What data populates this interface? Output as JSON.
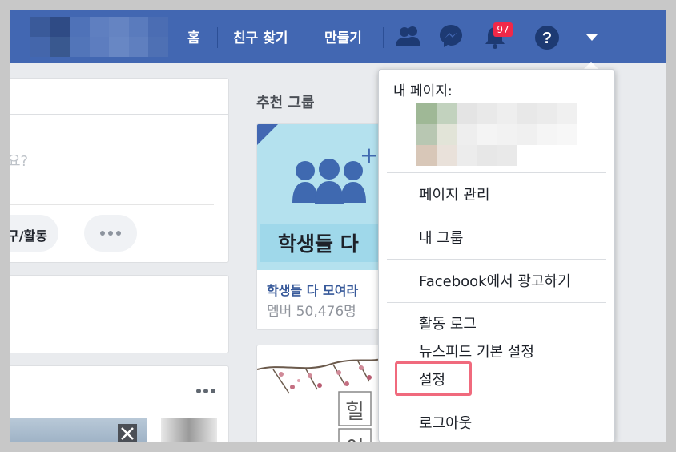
{
  "nav": {
    "home": "홈",
    "find_friends": "친구 찾기",
    "create": "만들기",
    "notification_count": "97"
  },
  "icons": {
    "friends": "friends-icon",
    "messenger": "messenger-icon",
    "notifications": "bell-icon",
    "help": "help-icon",
    "menu": "caret-down-icon"
  },
  "colors": {
    "brand": "#4267b2",
    "badge": "#f02849",
    "highlight": "#f06a7d"
  },
  "composer": {
    "placeholder_tail": "요?",
    "action_label": "친구/활동",
    "more_icon": "more-horizontal-icon"
  },
  "recommended": {
    "title": "추천 그룹",
    "group1": {
      "image_text": "학생들 다",
      "name": "학생들 다 모여라",
      "members": "멤버 50,476명"
    },
    "group2": {
      "char_top": "힐",
      "char_bottom": "이"
    }
  },
  "dropdown": {
    "my_pages_label": "내 페이지:",
    "items": [
      {
        "label": "페이지 관리"
      },
      {
        "label": "내 그룹"
      },
      {
        "label": "Facebook에서 광고하기"
      },
      {
        "label": "활동 로그"
      },
      {
        "label": "뉴스피드 기본 설정"
      },
      {
        "label": "설정"
      },
      {
        "label": "로그아웃"
      }
    ]
  }
}
